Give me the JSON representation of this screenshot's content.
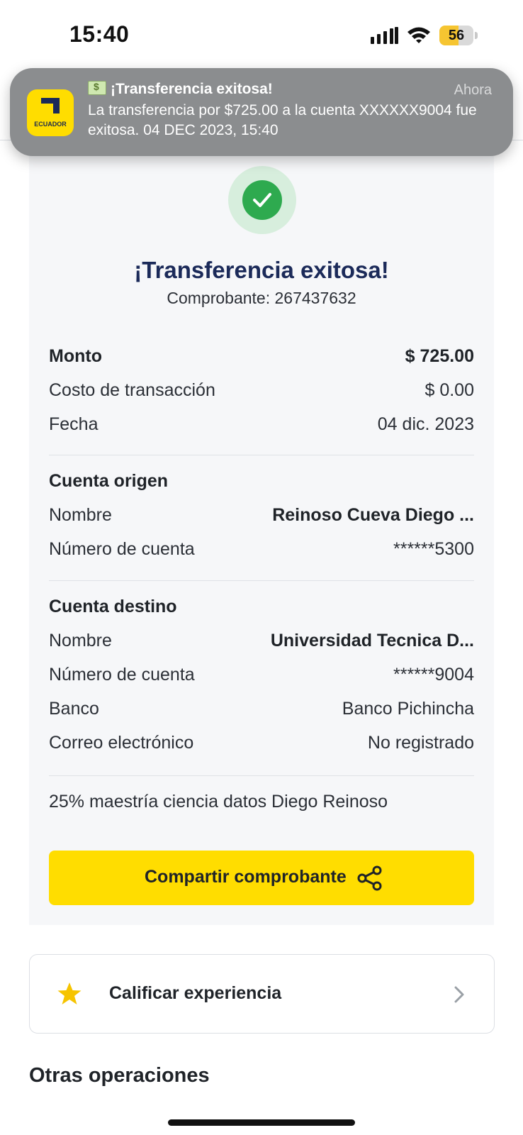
{
  "status_bar": {
    "time": "15:40",
    "battery": "56",
    "battery_level": 0.56,
    "battery_color": "#f6c531"
  },
  "notification": {
    "app_label": "ECUADOR",
    "title": "¡Transferencia exitosa!",
    "time": "Ahora",
    "body": "La transferencia por $725.00 a la cuenta XXXXXX9004 fue exitosa. 04 DEC 2023, 15:40"
  },
  "result": {
    "title": "¡Transferencia exitosa!",
    "receipt": "Comprobante: 267437632",
    "success_color": "#2eaa4f"
  },
  "summary": {
    "amount_label": "Monto",
    "amount_value": "$ 725.00",
    "cost_label": "Costo de transacción",
    "cost_value": "$ 0.00",
    "date_label": "Fecha",
    "date_value": "04 dic. 2023"
  },
  "origin": {
    "heading": "Cuenta origen",
    "name_label": "Nombre",
    "name_value": "Reinoso  Cueva Diego ...",
    "account_label": "Número de cuenta",
    "account_value": "******5300"
  },
  "destination": {
    "heading": "Cuenta destino",
    "name_label": "Nombre",
    "name_value": "Universidad Tecnica D...",
    "account_label": "Número de cuenta",
    "account_value": "******9004",
    "bank_label": "Banco",
    "bank_value": "Banco Pichincha",
    "email_label": "Correo electrónico",
    "email_value": "No registrado"
  },
  "note": "25% maestría ciencia datos Diego Reinoso",
  "share_button": {
    "label": "Compartir comprobante",
    "color": "#ffdd00"
  },
  "rate": {
    "label": "Calificar experiencia",
    "star_color": "#f6c400"
  },
  "other_operations": "Otras operaciones"
}
